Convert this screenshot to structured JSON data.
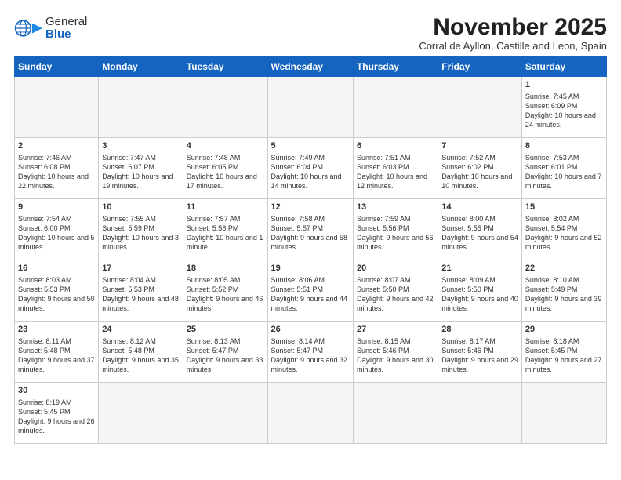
{
  "header": {
    "logo_line1": "General",
    "logo_line2": "Blue",
    "month": "November 2025",
    "location": "Corral de Ayllon, Castille and Leon, Spain"
  },
  "weekdays": [
    "Sunday",
    "Monday",
    "Tuesday",
    "Wednesday",
    "Thursday",
    "Friday",
    "Saturday"
  ],
  "weeks": [
    [
      {
        "day": "",
        "info": ""
      },
      {
        "day": "",
        "info": ""
      },
      {
        "day": "",
        "info": ""
      },
      {
        "day": "",
        "info": ""
      },
      {
        "day": "",
        "info": ""
      },
      {
        "day": "",
        "info": ""
      },
      {
        "day": "1",
        "info": "Sunrise: 7:45 AM\nSunset: 6:09 PM\nDaylight: 10 hours and 24 minutes."
      }
    ],
    [
      {
        "day": "2",
        "info": "Sunrise: 7:46 AM\nSunset: 6:08 PM\nDaylight: 10 hours and 22 minutes."
      },
      {
        "day": "3",
        "info": "Sunrise: 7:47 AM\nSunset: 6:07 PM\nDaylight: 10 hours and 19 minutes."
      },
      {
        "day": "4",
        "info": "Sunrise: 7:48 AM\nSunset: 6:05 PM\nDaylight: 10 hours and 17 minutes."
      },
      {
        "day": "5",
        "info": "Sunrise: 7:49 AM\nSunset: 6:04 PM\nDaylight: 10 hours and 14 minutes."
      },
      {
        "day": "6",
        "info": "Sunrise: 7:51 AM\nSunset: 6:03 PM\nDaylight: 10 hours and 12 minutes."
      },
      {
        "day": "7",
        "info": "Sunrise: 7:52 AM\nSunset: 6:02 PM\nDaylight: 10 hours and 10 minutes."
      },
      {
        "day": "8",
        "info": "Sunrise: 7:53 AM\nSunset: 6:01 PM\nDaylight: 10 hours and 7 minutes."
      }
    ],
    [
      {
        "day": "9",
        "info": "Sunrise: 7:54 AM\nSunset: 6:00 PM\nDaylight: 10 hours and 5 minutes."
      },
      {
        "day": "10",
        "info": "Sunrise: 7:55 AM\nSunset: 5:59 PM\nDaylight: 10 hours and 3 minutes."
      },
      {
        "day": "11",
        "info": "Sunrise: 7:57 AM\nSunset: 5:58 PM\nDaylight: 10 hours and 1 minute."
      },
      {
        "day": "12",
        "info": "Sunrise: 7:58 AM\nSunset: 5:57 PM\nDaylight: 9 hours and 58 minutes."
      },
      {
        "day": "13",
        "info": "Sunrise: 7:59 AM\nSunset: 5:56 PM\nDaylight: 9 hours and 56 minutes."
      },
      {
        "day": "14",
        "info": "Sunrise: 8:00 AM\nSunset: 5:55 PM\nDaylight: 9 hours and 54 minutes."
      },
      {
        "day": "15",
        "info": "Sunrise: 8:02 AM\nSunset: 5:54 PM\nDaylight: 9 hours and 52 minutes."
      }
    ],
    [
      {
        "day": "16",
        "info": "Sunrise: 8:03 AM\nSunset: 5:53 PM\nDaylight: 9 hours and 50 minutes."
      },
      {
        "day": "17",
        "info": "Sunrise: 8:04 AM\nSunset: 5:53 PM\nDaylight: 9 hours and 48 minutes."
      },
      {
        "day": "18",
        "info": "Sunrise: 8:05 AM\nSunset: 5:52 PM\nDaylight: 9 hours and 46 minutes."
      },
      {
        "day": "19",
        "info": "Sunrise: 8:06 AM\nSunset: 5:51 PM\nDaylight: 9 hours and 44 minutes."
      },
      {
        "day": "20",
        "info": "Sunrise: 8:07 AM\nSunset: 5:50 PM\nDaylight: 9 hours and 42 minutes."
      },
      {
        "day": "21",
        "info": "Sunrise: 8:09 AM\nSunset: 5:50 PM\nDaylight: 9 hours and 40 minutes."
      },
      {
        "day": "22",
        "info": "Sunrise: 8:10 AM\nSunset: 5:49 PM\nDaylight: 9 hours and 39 minutes."
      }
    ],
    [
      {
        "day": "23",
        "info": "Sunrise: 8:11 AM\nSunset: 5:48 PM\nDaylight: 9 hours and 37 minutes."
      },
      {
        "day": "24",
        "info": "Sunrise: 8:12 AM\nSunset: 5:48 PM\nDaylight: 9 hours and 35 minutes."
      },
      {
        "day": "25",
        "info": "Sunrise: 8:13 AM\nSunset: 5:47 PM\nDaylight: 9 hours and 33 minutes."
      },
      {
        "day": "26",
        "info": "Sunrise: 8:14 AM\nSunset: 5:47 PM\nDaylight: 9 hours and 32 minutes."
      },
      {
        "day": "27",
        "info": "Sunrise: 8:15 AM\nSunset: 5:46 PM\nDaylight: 9 hours and 30 minutes."
      },
      {
        "day": "28",
        "info": "Sunrise: 8:17 AM\nSunset: 5:46 PM\nDaylight: 9 hours and 29 minutes."
      },
      {
        "day": "29",
        "info": "Sunrise: 8:18 AM\nSunset: 5:45 PM\nDaylight: 9 hours and 27 minutes."
      }
    ],
    [
      {
        "day": "30",
        "info": "Sunrise: 8:19 AM\nSunset: 5:45 PM\nDaylight: 9 hours and 26 minutes."
      },
      {
        "day": "",
        "info": ""
      },
      {
        "day": "",
        "info": ""
      },
      {
        "day": "",
        "info": ""
      },
      {
        "day": "",
        "info": ""
      },
      {
        "day": "",
        "info": ""
      },
      {
        "day": "",
        "info": ""
      }
    ]
  ]
}
